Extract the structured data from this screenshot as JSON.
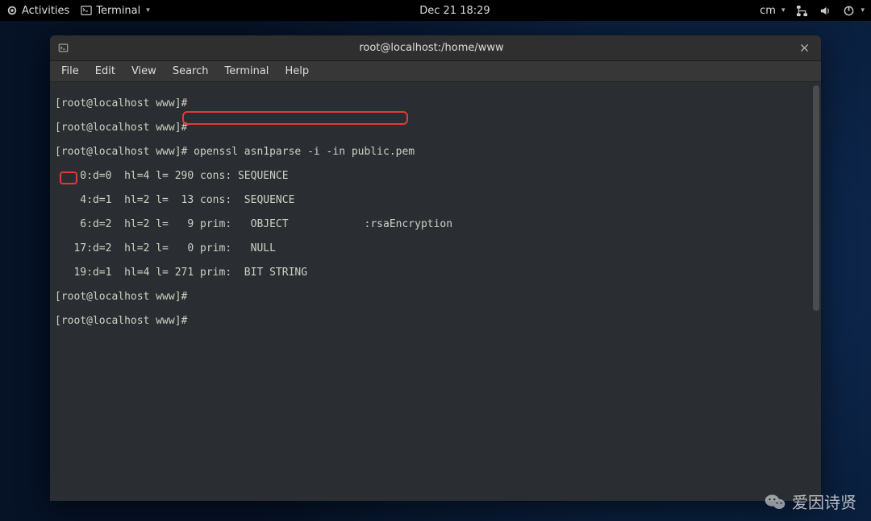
{
  "top_panel": {
    "activities": "Activities",
    "app": "Terminal",
    "datetime": "Dec 21  18:29",
    "ime": "cm"
  },
  "window": {
    "title": "root@localhost:/home/www"
  },
  "menu": {
    "file": "File",
    "edit": "Edit",
    "view": "View",
    "search": "Search",
    "terminal": "Terminal",
    "help": "Help"
  },
  "terminal": {
    "lines": [
      "[root@localhost www]# ",
      "[root@localhost www]# ",
      "[root@localhost www]# openssl asn1parse -i -in public.pem ",
      "    0:d=0  hl=4 l= 290 cons: SEQUENCE          ",
      "    4:d=1  hl=2 l=  13 cons:  SEQUENCE          ",
      "    6:d=2  hl=2 l=   9 prim:   OBJECT            :rsaEncryption",
      "   17:d=2  hl=2 l=   0 prim:   NULL              ",
      "   19:d=1  hl=4 l= 271 prim:  BIT STRING        ",
      "[root@localhost www]# ",
      "[root@localhost www]# "
    ],
    "highlighted_command": "openssl asn1parse -i -in public.pem",
    "highlighted_offset": "19"
  },
  "watermark": {
    "text": "爱因诗贤"
  }
}
